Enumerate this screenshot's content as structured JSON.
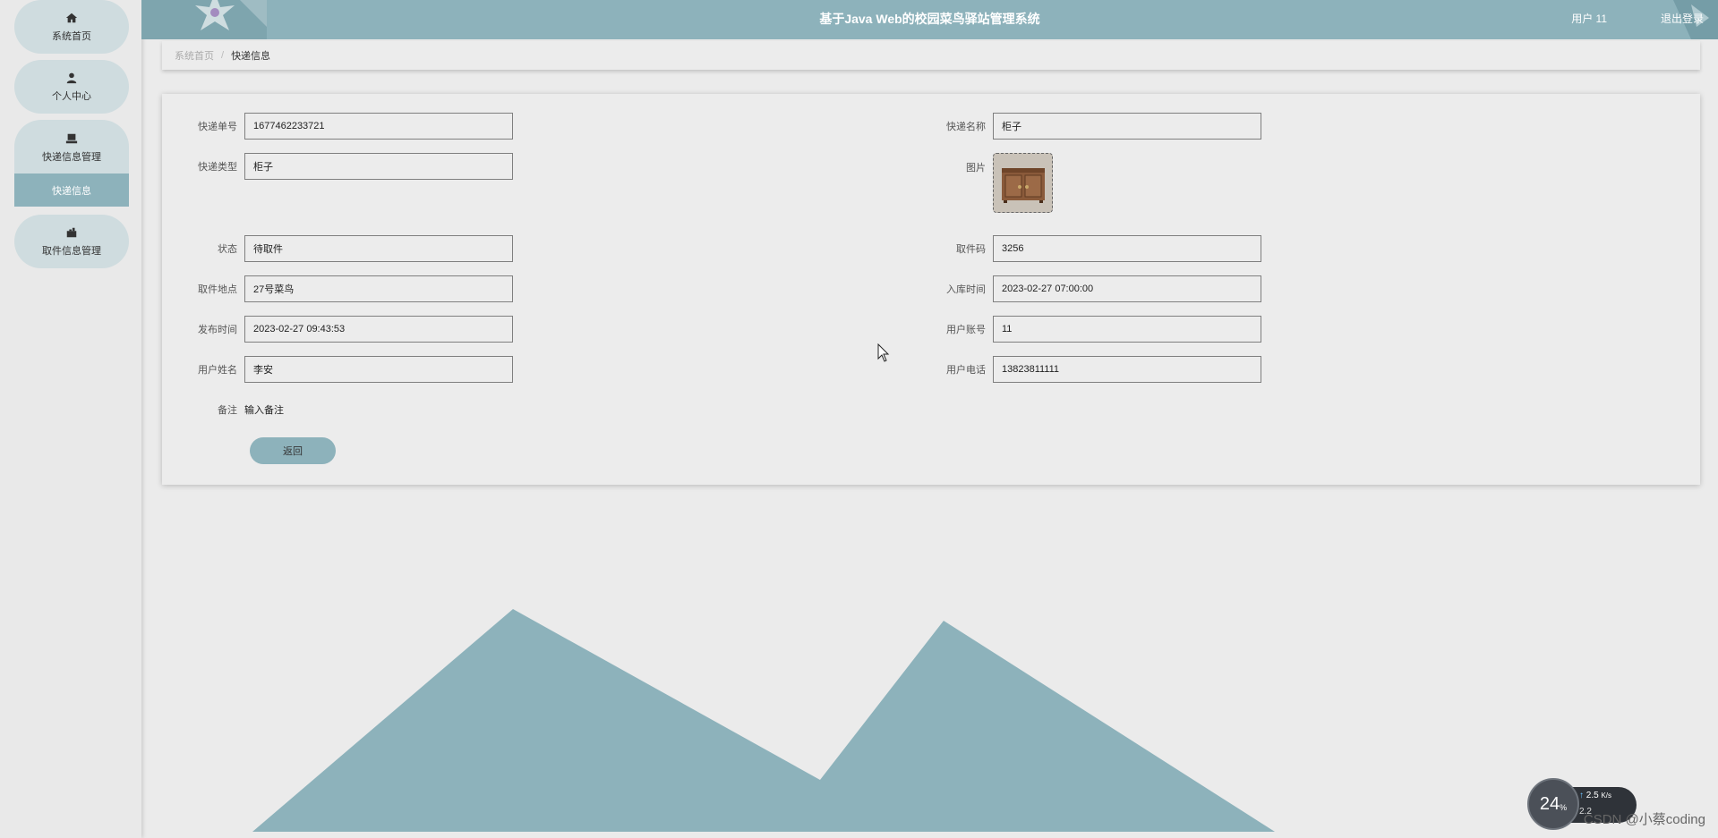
{
  "app": {
    "title": "基于Java Web的校园菜鸟驿站管理系统",
    "user_label": "用户 11",
    "logout_label": "退出登录"
  },
  "sidebar": {
    "items": [
      {
        "label": "系统首页",
        "icon": "home-icon"
      },
      {
        "label": "个人中心",
        "icon": "user-icon"
      },
      {
        "label": "快递信息管理",
        "icon": "package-icon"
      },
      {
        "label": "取件信息管理",
        "icon": "briefcase-icon"
      }
    ],
    "sub_item": {
      "label": "快递信息"
    }
  },
  "breadcrumb": {
    "home": "系统首页",
    "separator": "/",
    "current": "快递信息"
  },
  "form": {
    "fields": {
      "express_no": {
        "label": "快递单号",
        "value": "1677462233721"
      },
      "express_name": {
        "label": "快递名称",
        "value": "柜子"
      },
      "express_type": {
        "label": "快递类型",
        "value": "柜子"
      },
      "image": {
        "label": "图片"
      },
      "status": {
        "label": "状态",
        "value": "待取件"
      },
      "pickup_code": {
        "label": "取件码",
        "value": "3256"
      },
      "pickup_location": {
        "label": "取件地点",
        "value": "27号菜鸟"
      },
      "stock_time": {
        "label": "入库时间",
        "value": "2023-02-27 07:00:00"
      },
      "publish_time": {
        "label": "发布时间",
        "value": "2023-02-27 09:43:53"
      },
      "user_account": {
        "label": "用户账号",
        "value": "11"
      },
      "user_name": {
        "label": "用户姓名",
        "value": "李安"
      },
      "user_phone": {
        "label": "用户电话",
        "value": "13823811111"
      },
      "note": {
        "label": "备注",
        "value": "输入备注"
      }
    },
    "back_button": "返回"
  },
  "overlay": {
    "cpu_percent": "24",
    "percent_sign": "%",
    "up_speed": "2.5",
    "up_unit": "K/s",
    "down_speed": "2.2",
    "watermark": "CSDN @小蔡coding"
  },
  "colors": {
    "accent": "#8db2bb",
    "nav_item_bg": "#cfdcdf",
    "page_bg": "#ebebeb"
  }
}
